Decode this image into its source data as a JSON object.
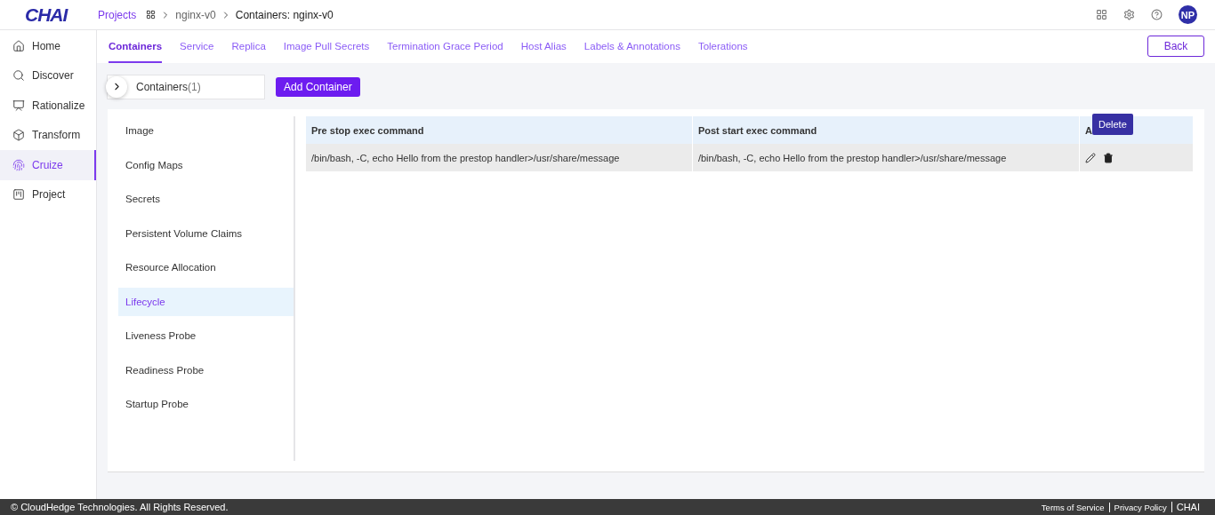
{
  "logo": "CHAI",
  "breadcrumb": [
    {
      "label": "Projects",
      "kind": "link"
    },
    {
      "kind": "grid"
    },
    {
      "label": "nginx-v0",
      "kind": "text"
    },
    {
      "label": "Containers: nginx-v0",
      "kind": "current"
    }
  ],
  "user": {
    "initials": "NP"
  },
  "sidebar": {
    "items": [
      {
        "label": "Home",
        "selected": false
      },
      {
        "label": "Discover",
        "selected": false
      },
      {
        "label": "Rationalize",
        "selected": false
      },
      {
        "label": "Transform",
        "selected": false
      },
      {
        "label": "Cruize",
        "selected": true
      },
      {
        "label": "Project",
        "selected": false
      }
    ]
  },
  "tabs": [
    {
      "label": "Containers",
      "selected": true
    },
    {
      "label": "Service",
      "selected": false
    },
    {
      "label": "Replica",
      "selected": false
    },
    {
      "label": "Image Pull Secrets",
      "selected": false
    },
    {
      "label": "Termination Grace Period",
      "selected": false
    },
    {
      "label": "Host Alias",
      "selected": false
    },
    {
      "label": "Labels & Annotations",
      "selected": false
    },
    {
      "label": "Tolerations",
      "selected": false
    }
  ],
  "back_button": "Back",
  "container_selector": {
    "label": "Containers",
    "count": "(1)"
  },
  "add_button": "Add Container",
  "sections": [
    {
      "label": "Image",
      "selected": false
    },
    {
      "label": "Config Maps",
      "selected": false
    },
    {
      "label": "Secrets",
      "selected": false
    },
    {
      "label": "Persistent Volume Claims",
      "selected": false
    },
    {
      "label": "Resource Allocation",
      "selected": false
    },
    {
      "label": "Lifecycle",
      "selected": true
    },
    {
      "label": "Liveness Probe",
      "selected": false
    },
    {
      "label": "Readiness Probe",
      "selected": false
    },
    {
      "label": "Startup Probe",
      "selected": false
    }
  ],
  "table": {
    "columns": [
      "Pre stop exec command",
      "Post start exec command",
      "A"
    ],
    "rows": [
      {
        "cells": [
          "/bin/bash, -C, echo Hello from the prestop handler>/usr/share/message",
          "/bin/bash, -C, echo Hello from the prestop handler>/usr/share/message"
        ]
      }
    ]
  },
  "tooltip": "Delete",
  "footer": {
    "copyright": "© CloudHedge Technologies. All Rights Reserved.",
    "links": [
      "Terms of Service",
      "Privacy Policy",
      "CHAI"
    ]
  }
}
